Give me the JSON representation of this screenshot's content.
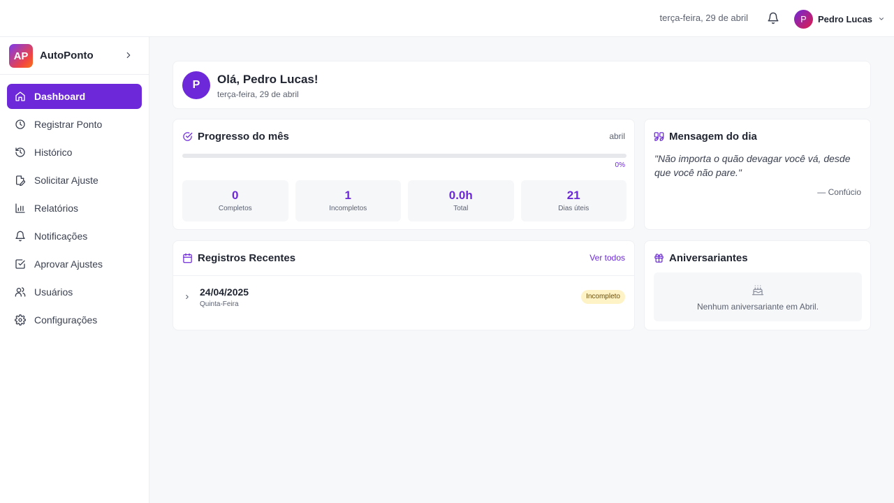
{
  "header": {
    "date": "terça-feira, 29 de abril",
    "user_initial": "P",
    "user_name": "Pedro Lucas",
    "icons": [
      "bell-icon",
      "chevron-down-icon"
    ]
  },
  "sidebar": {
    "logo_text": "AP",
    "app_name": "AutoPonto",
    "items": [
      {
        "label": "Dashboard",
        "icon": "home-icon",
        "active": true
      },
      {
        "label": "Registrar Ponto",
        "icon": "clock-icon",
        "active": false
      },
      {
        "label": "Histórico",
        "icon": "history-icon",
        "active": false
      },
      {
        "label": "Solicitar Ajuste",
        "icon": "file-edit-icon",
        "active": false
      },
      {
        "label": "Relatórios",
        "icon": "bar-chart-icon",
        "active": false
      },
      {
        "label": "Notificações",
        "icon": "bell-icon",
        "active": false
      },
      {
        "label": "Aprovar Ajustes",
        "icon": "check-square-icon",
        "active": false
      },
      {
        "label": "Usuários",
        "icon": "users-icon",
        "active": false
      },
      {
        "label": "Configurações",
        "icon": "gear-icon",
        "active": false
      }
    ]
  },
  "greeting": {
    "initial": "P",
    "title": "Olá, Pedro Lucas!",
    "date": "terça-feira, 29 de abril"
  },
  "progress": {
    "title": "Progresso do mês",
    "month": "abril",
    "percent_value": 0,
    "percent_label": "0%",
    "stats": [
      {
        "value": "0",
        "label": "Completos"
      },
      {
        "value": "1",
        "label": "Incompletos"
      },
      {
        "value": "0.0h",
        "label": "Total"
      },
      {
        "value": "21",
        "label": "Dias úteis"
      }
    ]
  },
  "message": {
    "title": "Mensagem do dia",
    "quote": "\"Não importa o quão devagar você vá, desde que você não pare.\"",
    "author": "— Confúcio"
  },
  "recent": {
    "title": "Registros Recentes",
    "see_all": "Ver todos",
    "rows": [
      {
        "date": "24/04/2025",
        "day": "Quinta-Feira",
        "status": "Incompleto"
      }
    ]
  },
  "birthdays": {
    "title": "Aniversariantes",
    "empty_message": "Nenhum aniversariante em Abril."
  },
  "colors": {
    "accent": "#6d28d9",
    "badge_bg": "#fef3c7",
    "background": "#f7f8fa"
  }
}
